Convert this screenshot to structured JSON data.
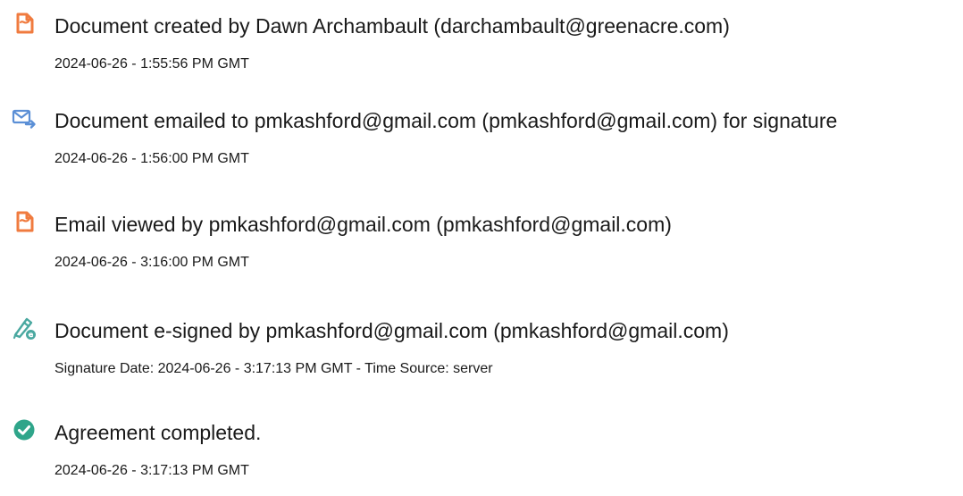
{
  "colors": {
    "created_icon": "#f07b3f",
    "email_icon": "#5b8fd6",
    "viewed_icon": "#f07b3f",
    "signed_icon": "#4aa8a0",
    "completed_icon": "#2fa58a",
    "text": "#1a1a1a"
  },
  "events": [
    {
      "icon": "document-icon",
      "title": "Document created by Dawn Archambault (darchambault@greenacre.com)",
      "meta": "2024-06-26 - 1:55:56 PM GMT"
    },
    {
      "icon": "email-send-icon",
      "title": "Document emailed to pmkashford@gmail.com (pmkashford@gmail.com) for signature",
      "meta": "2024-06-26 - 1:56:00 PM GMT"
    },
    {
      "icon": "document-icon",
      "title": "Email viewed by pmkashford@gmail.com (pmkashford@gmail.com)",
      "meta": "2024-06-26 - 3:16:00 PM GMT"
    },
    {
      "icon": "pen-esign-icon",
      "title": "Document e-signed by pmkashford@gmail.com (pmkashford@gmail.com)",
      "meta": "Signature Date: 2024-06-26 - 3:17:13 PM GMT - Time Source: server"
    },
    {
      "icon": "check-circle-icon",
      "title": "Agreement completed.",
      "meta": "2024-06-26 - 3:17:13 PM GMT"
    }
  ]
}
